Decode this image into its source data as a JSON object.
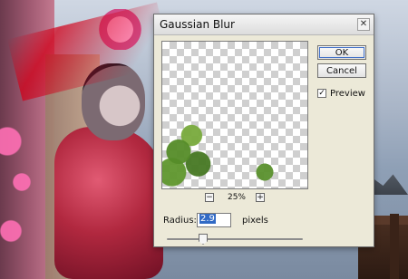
{
  "window": {
    "title": "Gaussian Blur",
    "close_glyph": "✕"
  },
  "buttons": {
    "ok": "OK",
    "cancel": "Cancel"
  },
  "options": {
    "preview_label": "Preview",
    "preview_checked": true,
    "check_glyph": "✓"
  },
  "zoom": {
    "minus": "−",
    "value": "25%",
    "plus": "+"
  },
  "radius": {
    "label": "Radius:",
    "value": "2.9",
    "units": "pixels",
    "slider_fraction": 0.25
  },
  "colors": {
    "selection": "#316ac5",
    "dialog_bg": "#ece9d8"
  }
}
